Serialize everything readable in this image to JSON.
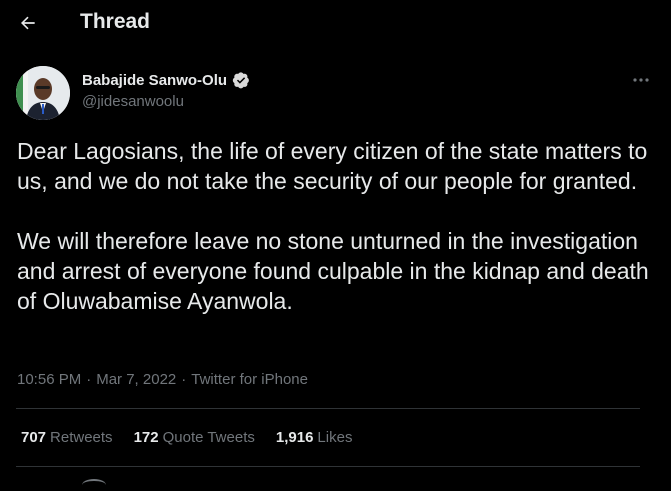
{
  "header": {
    "title": "Thread",
    "back_icon": "arrow-left-icon"
  },
  "tweet": {
    "author": {
      "name": "Babajide Sanwo-Olu",
      "handle": "@jidesanwoolu",
      "verified_icon": "verified-badge-icon",
      "avatar_icon": "avatar-photo"
    },
    "more_icon": "ellipsis-icon",
    "paragraphs": [
      "Dear Lagosians, the life of every citizen of the state matters to us, and we do not take the security of our people for granted.",
      "We will therefore leave no stone unturned in the investigation and arrest of everyone found culpable in the kidnap and death of Oluwabamise Ayanwola."
    ],
    "time": "10:56 PM",
    "date": "Mar 7, 2022",
    "source": "Twitter for iPhone",
    "separator": "·"
  },
  "stats": {
    "retweets": {
      "count": "707",
      "label": "Retweets"
    },
    "quotes": {
      "count": "172",
      "label": "Quote Tweets"
    },
    "likes": {
      "count": "1,916",
      "label": "Likes"
    }
  },
  "colors": {
    "background": "#000000",
    "text": "#e7e9ea",
    "secondary": "#71767b",
    "divider": "#2f3336",
    "verified": "#d9d9d9"
  }
}
